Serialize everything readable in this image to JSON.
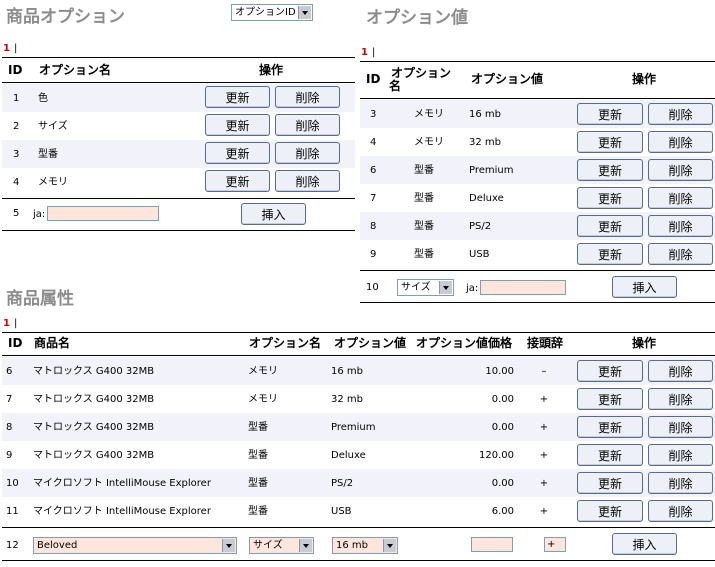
{
  "options": {
    "title": "商品オプション",
    "sort_select": "オプションID",
    "page": "1",
    "page_sep": "|",
    "headers": {
      "id": "ID",
      "name": "オプション名",
      "ops": "操作"
    },
    "rows": [
      {
        "id": "1",
        "name": "色"
      },
      {
        "id": "2",
        "name": "サイズ"
      },
      {
        "id": "3",
        "name": "型番"
      },
      {
        "id": "4",
        "name": "メモリ"
      }
    ],
    "new_row": {
      "id": "5",
      "lang": "ja:",
      "value": ""
    }
  },
  "values": {
    "title": "オプション値",
    "page": "1",
    "page_sep": "|",
    "headers": {
      "id": "ID",
      "name_l1": "オプション",
      "name_l2": "名",
      "value": "オプション値",
      "ops": "操作"
    },
    "rows": [
      {
        "id": "3",
        "name": "メモリ",
        "value": "16 mb"
      },
      {
        "id": "4",
        "name": "メモリ",
        "value": "32 mb"
      },
      {
        "id": "6",
        "name": "型番",
        "value": "Premium"
      },
      {
        "id": "7",
        "name": "型番",
        "value": "Deluxe"
      },
      {
        "id": "8",
        "name": "型番",
        "value": "PS/2"
      },
      {
        "id": "9",
        "name": "型番",
        "value": "USB"
      }
    ],
    "new_row": {
      "id": "10",
      "option_select": "サイズ",
      "lang": "ja:",
      "value": ""
    }
  },
  "attributes": {
    "title": "商品属性",
    "page": "1",
    "page_sep": "|",
    "headers": {
      "id": "ID",
      "product": "商品名",
      "option": "オプション名",
      "value": "オプション値",
      "price": "オプション値価格",
      "prefix": "接頭辞",
      "ops": "操作"
    },
    "rows": [
      {
        "id": "6",
        "product": "マトロックス G400 32MB",
        "option": "メモリ",
        "value": "16 mb",
        "price": "10.00",
        "prefix": "–"
      },
      {
        "id": "7",
        "product": "マトロックス G400 32MB",
        "option": "メモリ",
        "value": "32 mb",
        "price": "0.00",
        "prefix": "+"
      },
      {
        "id": "8",
        "product": "マトロックス G400 32MB",
        "option": "型番",
        "value": "Premium",
        "price": "0.00",
        "prefix": "+"
      },
      {
        "id": "9",
        "product": "マトロックス G400 32MB",
        "option": "型番",
        "value": "Deluxe",
        "price": "120.00",
        "prefix": "+"
      },
      {
        "id": "10",
        "product": "マイクロソフト IntelliMouse Explorer",
        "option": "型番",
        "value": "PS/2",
        "price": "0.00",
        "prefix": "+"
      },
      {
        "id": "11",
        "product": "マイクロソフト IntelliMouse Explorer",
        "option": "型番",
        "value": "USB",
        "price": "6.00",
        "prefix": "+"
      }
    ],
    "new_row": {
      "id": "12",
      "product_select": "Beloved",
      "option_select": "サイズ",
      "value_select": "16 mb",
      "price": "",
      "prefix": "+"
    }
  },
  "buttons": {
    "update": "更新",
    "delete": "削除",
    "insert": "挿入"
  }
}
